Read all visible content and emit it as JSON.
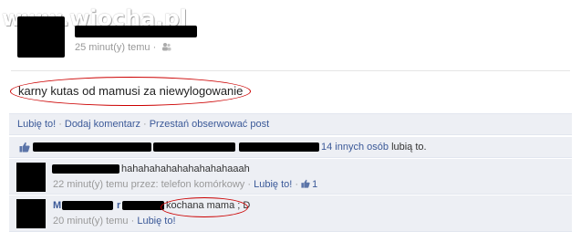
{
  "watermark": {
    "text": "www.wiocha.pl"
  },
  "post": {
    "time": "25 minut(y) temu",
    "visibility_separator": "·",
    "visibility_icon": "people-icon",
    "status_text": "karny kutas od mamusi za niewylogowanie",
    "actions": {
      "like": "Lubię to!",
      "sep1": "·",
      "comment": "Dodaj komentarz",
      "sep2": "·",
      "unfollow": "Przestań obserwować post"
    }
  },
  "likes": {
    "icon": "thumbs-up-icon",
    "others_link": "14 innych osób",
    "suffix": "lubią to."
  },
  "comments": [
    {
      "text": "hahahahahahahahahahaaah",
      "time": "22 minut(y) temu przez: telefon komórkowy",
      "sep": "·",
      "like": "Lubię to!",
      "sep2": "·",
      "like_count": "1",
      "like_icon": "thumbs-up-icon"
    },
    {
      "name_initial": "M",
      "name_mid_initial": "r",
      "text": "kochana mama ; D",
      "time": "20 minut(y) temu",
      "sep": "·",
      "like": "Lubię to!"
    }
  ],
  "colors": {
    "link": "#3b5998",
    "panel": "#edeff4",
    "highlight_circle": "#cc0000"
  }
}
